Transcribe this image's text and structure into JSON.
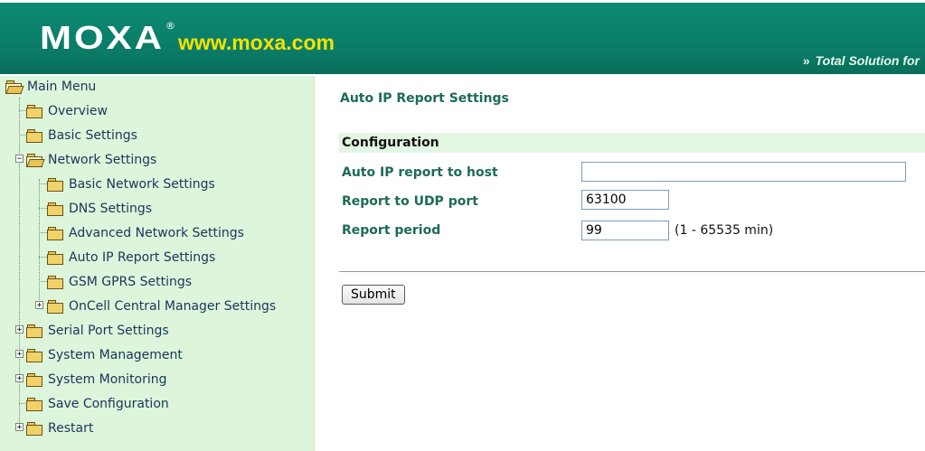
{
  "header": {
    "logo_text": "MOXA",
    "logo_reg": "®",
    "url_text": "www.moxa.com",
    "tagline_arrows": "»",
    "tagline": "Total Solution for"
  },
  "sidebar": {
    "items": [
      {
        "label": "Main Menu",
        "icon": "open-folder-icon",
        "expander": ""
      },
      {
        "label": "Overview",
        "icon": "folder-icon",
        "expander": ""
      },
      {
        "label": "Basic Settings",
        "icon": "folder-icon",
        "expander": ""
      },
      {
        "label": "Network Settings",
        "icon": "open-folder-icon",
        "expander": "−"
      },
      {
        "label": "Basic Network Settings",
        "icon": "folder-icon",
        "expander": ""
      },
      {
        "label": "DNS Settings",
        "icon": "folder-icon",
        "expander": ""
      },
      {
        "label": "Advanced Network Settings",
        "icon": "folder-icon",
        "expander": ""
      },
      {
        "label": "Auto IP Report Settings",
        "icon": "folder-icon",
        "expander": ""
      },
      {
        "label": "GSM GPRS Settings",
        "icon": "folder-icon",
        "expander": ""
      },
      {
        "label": "OnCell Central Manager Settings",
        "icon": "folder-icon",
        "expander": "+"
      },
      {
        "label": "Serial Port Settings",
        "icon": "folder-icon",
        "expander": "+"
      },
      {
        "label": "System Management",
        "icon": "folder-icon",
        "expander": "+"
      },
      {
        "label": "System Monitoring",
        "icon": "folder-icon",
        "expander": "+"
      },
      {
        "label": "Save Configuration",
        "icon": "folder-icon",
        "expander": ""
      },
      {
        "label": "Restart",
        "icon": "folder-icon",
        "expander": "+"
      }
    ]
  },
  "main": {
    "title": "Auto IP Report Settings",
    "section_header": "Configuration",
    "fields": {
      "host": {
        "label": "Auto IP report to host",
        "value": ""
      },
      "udp_port": {
        "label": "Report to UDP port",
        "value": "63100"
      },
      "period": {
        "label": "Report period",
        "value": "99",
        "hint": "(1 - 65535 min)"
      }
    },
    "submit_label": "Submit"
  },
  "colors": {
    "header_green": "#0a7f69",
    "sidebar_bg": "#dcf5db",
    "label_green": "#1c6b57",
    "url_yellow": "#f4e200"
  }
}
